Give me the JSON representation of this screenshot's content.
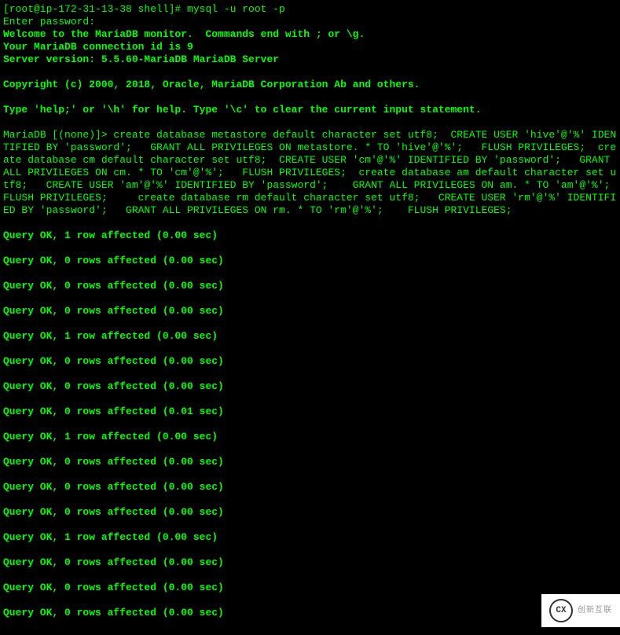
{
  "prompt": "[root@ip-172-31-13-38 shell]# mysql -u root -p",
  "enter_password": "Enter password:",
  "welcome": "Welcome to the MariaDB monitor.  Commands end with ; or \\g.",
  "conn_id": "Your MariaDB connection id is 9",
  "server_version": "Server version: 5.5.60-MariaDB MariaDB Server",
  "copyright": "Copyright (c) 2000, 2018, Oracle, MariaDB Corporation Ab and others.",
  "help_line": "Type 'help;' or '\\h' for help. Type '\\c' to clear the current input statement.",
  "sql_block": "MariaDB [(none)]> create database metastore default character set utf8;  CREATE USER 'hive'@'%' IDENTIFIED BY 'password';   GRANT ALL PRIVILEGES ON metastore. * TO 'hive'@'%';   FLUSH PRIVILEGES;  create database cm default character set utf8;  CREATE USER 'cm'@'%' IDENTIFIED BY 'password';   GRANT ALL PRIVILEGES ON cm. * TO 'cm'@'%';   FLUSH PRIVILEGES;  create database am default character set utf8;   CREATE USER 'am'@'%' IDENTIFIED BY 'password';    GRANT ALL PRIVILEGES ON am. * TO 'am'@'%';    FLUSH PRIVILEGES;     create database rm default character set utf8;   CREATE USER 'rm'@'%' IDENTIFIED BY 'password';   GRANT ALL PRIVILEGES ON rm. * TO 'rm'@'%';    FLUSH PRIVILEGES;",
  "results": [
    "Query OK, 1 row affected (0.00 sec)",
    "Query OK, 0 rows affected (0.00 sec)",
    "Query OK, 0 rows affected (0.00 sec)",
    "Query OK, 0 rows affected (0.00 sec)",
    "Query OK, 1 row affected (0.00 sec)",
    "Query OK, 0 rows affected (0.00 sec)",
    "Query OK, 0 rows affected (0.00 sec)",
    "Query OK, 0 rows affected (0.01 sec)",
    "Query OK, 1 row affected (0.00 sec)",
    "Query OK, 0 rows affected (0.00 sec)",
    "Query OK, 0 rows affected (0.00 sec)",
    "Query OK, 0 rows affected (0.00 sec)",
    "Query OK, 1 row affected (0.00 sec)",
    "Query OK, 0 rows affected (0.00 sec)",
    "Query OK, 0 rows affected (0.00 sec)",
    "Query OK, 0 rows affected (0.00 sec)"
  ],
  "watermark": {
    "icon_text": "CX",
    "label": "创新互联"
  }
}
